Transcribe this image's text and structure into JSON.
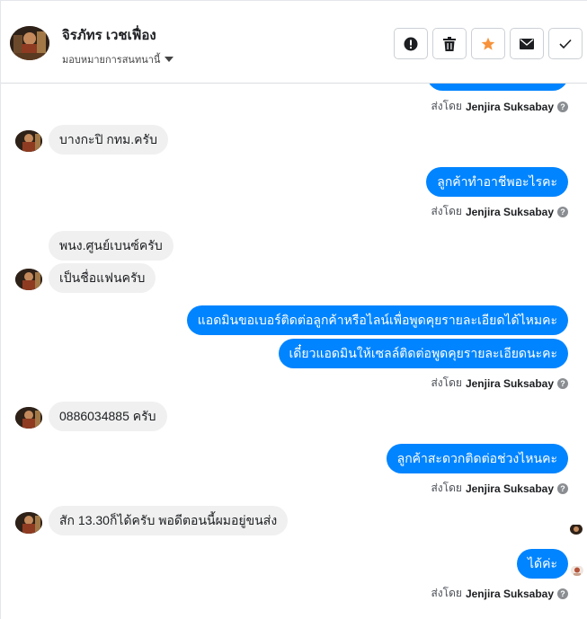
{
  "header": {
    "name": "จิรภัทร เวชเฟื่อง",
    "assign_label": "มอบหมายการสนทนานี้"
  },
  "actions": [
    {
      "icon": "alert-icon"
    },
    {
      "icon": "trash-icon"
    },
    {
      "icon": "star-icon",
      "color": "#f7923b"
    },
    {
      "icon": "mail-icon"
    },
    {
      "icon": "check-icon"
    }
  ],
  "sent_prefix": "ส่งโดย",
  "agent_name": "Jenjira Suksabay",
  "messages": {
    "c1": "บางกะปิ กทม.ครับ",
    "a1": "ลูกค้าทำอาชีพอะไรคะ",
    "c2": "พนง.ศูนย์เบนซ์ครับ",
    "c3": "เป็นชื่อแฟนครับ",
    "a2": "แอดมินขอเบอร์ติดต่อลูกค้าหรือไลน์เพื่อพูดคุยรายละเอียดได้ไหมคะ",
    "a3": "เดี๋ยวแอดมินให้เซลล์ติดต่อพูดคุยรายละเอียดนะคะ",
    "c4": "0886034885 ครับ",
    "a4": "ลูกค้าสะดวกติดต่อช่วงไหนคะ",
    "c5": "สัก 13.30ก็ได้ครับ พอดีตอนนี้ผมอยู่ขนส่ง",
    "a5": "ได้ค่ะ"
  },
  "colors": {
    "outgoing_bubble": "#0084ff",
    "incoming_bubble": "#f0f0f0"
  }
}
